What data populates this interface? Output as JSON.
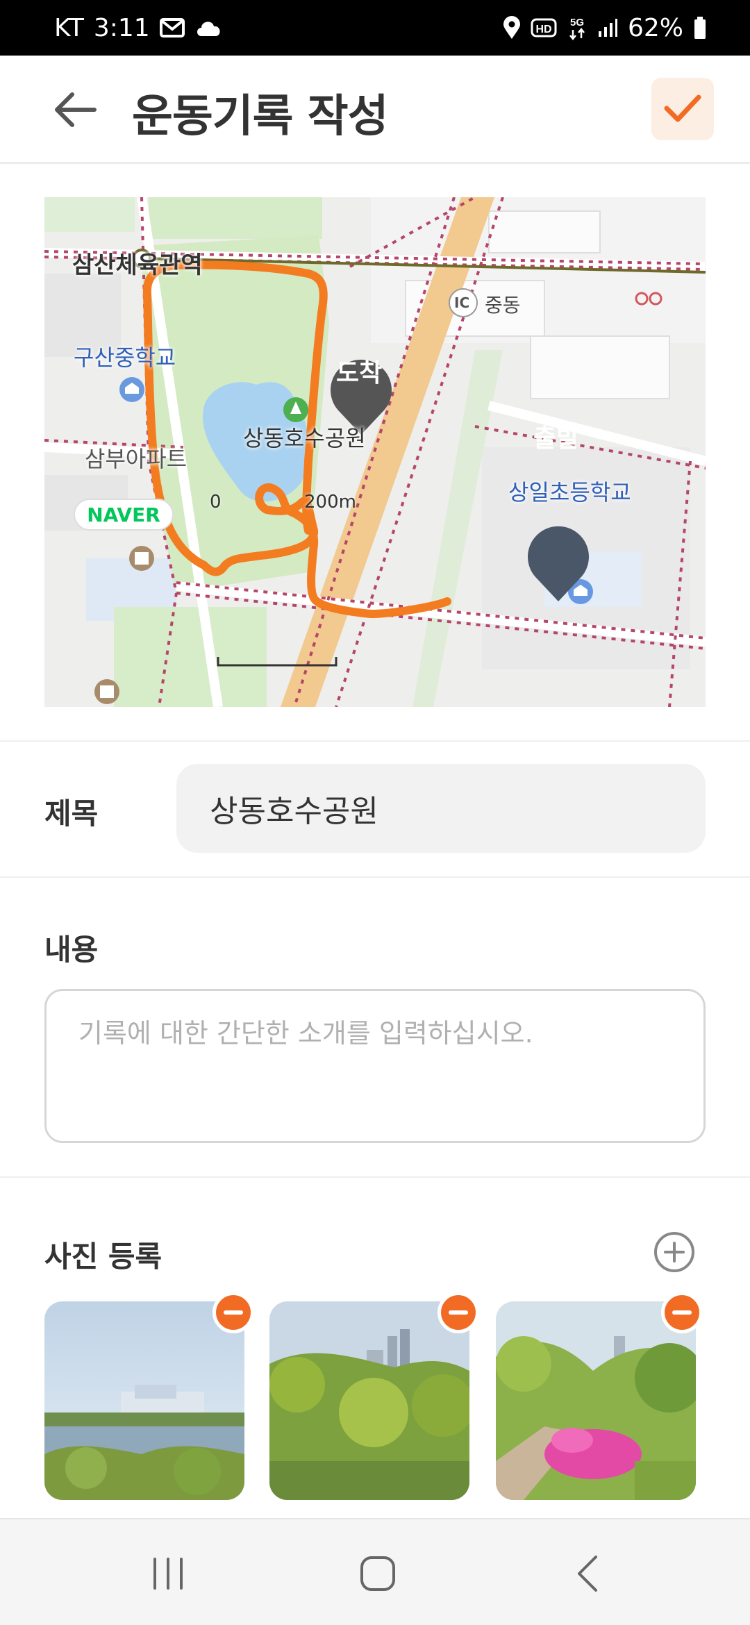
{
  "status_bar": {
    "carrier": "KT",
    "time": "3:11",
    "battery": "62%",
    "icons": [
      "mail-icon",
      "cloud-icon",
      "location-icon",
      "hd-icon",
      "5g-icon",
      "signal-icon",
      "battery-icon"
    ]
  },
  "header": {
    "title": "운동기록 작성",
    "back_icon": "arrow-left-icon",
    "confirm_icon": "check-icon"
  },
  "map": {
    "labels": {
      "station": "삼산체육관역",
      "school1": "구산중학교",
      "apartment": "삼부아파트",
      "park": "상동호수공원",
      "school2": "상일초등학교",
      "ic": "IC",
      "ic_name": "중동"
    },
    "markers": {
      "arrival": "도착",
      "departure": "출발"
    },
    "logo": "NAVER",
    "scale_start": "0",
    "scale_end": "200m"
  },
  "form": {
    "title_label": "제목",
    "title_value": "상동호수공원",
    "content_label": "내용",
    "content_placeholder": "기록에 대한 간단한 소개를 입력하십시오.",
    "photo_label": "사진 등록"
  },
  "photos": [
    {
      "scene": "lake-with-buildings"
    },
    {
      "scene": "green-trees-park"
    },
    {
      "scene": "azalea-path"
    }
  ],
  "colors": {
    "accent": "#f26b25",
    "route": "#f47c20",
    "marker": "#555555",
    "marker_departure": "#4a5768"
  }
}
